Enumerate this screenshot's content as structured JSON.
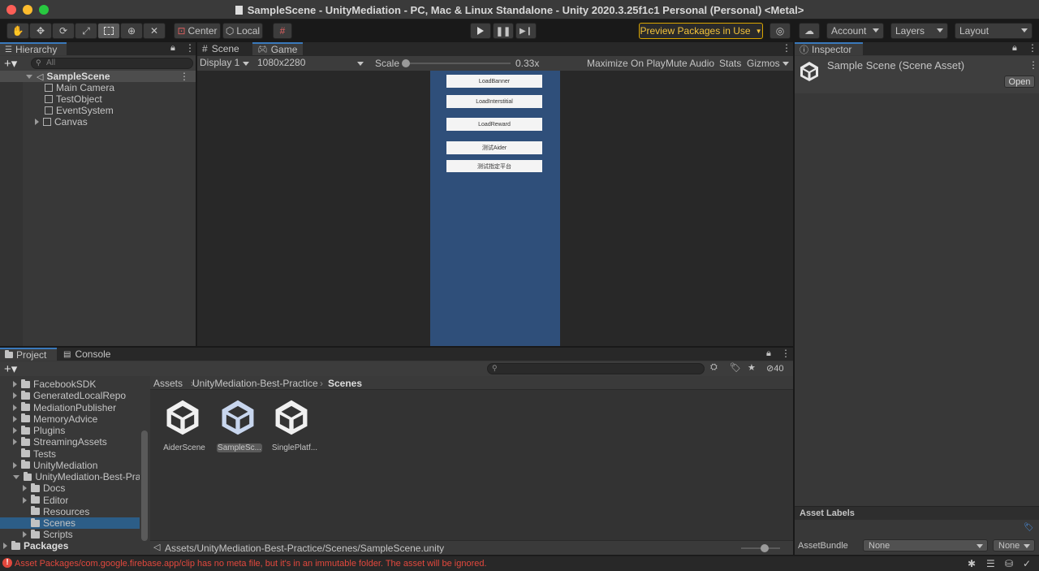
{
  "window": {
    "title": "SampleScene - UnityMediation - PC, Mac & Linux Standalone - Unity 2020.3.25f1c1 Personal (Personal) <Metal>"
  },
  "toolbar": {
    "center_label": "Center",
    "local_label": "Local",
    "preview_packages_label": "Preview Packages in Use",
    "account_label": "Account",
    "layers_label": "Layers",
    "layout_label": "Layout"
  },
  "hierarchy": {
    "tab_label": "Hierarchy",
    "search_placeholder": "All",
    "scene_name": "SampleScene",
    "items": [
      {
        "label": "Main Camera"
      },
      {
        "label": "TestObject"
      },
      {
        "label": "EventSystem"
      },
      {
        "label": "Canvas"
      }
    ]
  },
  "game_view": {
    "tab_scene": "Scene",
    "tab_game": "Game",
    "display": "Display 1",
    "resolution": "1080x2280",
    "scale_label": "Scale",
    "scale_value": "0.33x",
    "scale_slider_fraction": 0.0,
    "maximize_label": "Maximize On Play",
    "mute_label": "Mute Audio",
    "stats_label": "Stats",
    "gizmos_label": "Gizmos",
    "background_color": "#2f4f7a",
    "buttons": [
      "LoadBanner",
      "LoadInterstitial",
      "LoadReward",
      "测试Aider",
      "测试指定平台"
    ]
  },
  "inspector": {
    "tab_label": "Inspector",
    "asset_title": "Sample Scene (Scene Asset)",
    "open_label": "Open",
    "asset_labels_title": "Asset Labels",
    "asset_bundle_label": "AssetBundle",
    "asset_bundle_value": "None",
    "asset_bundle_variant": "None"
  },
  "project": {
    "tab_project": "Project",
    "tab_console": "Console",
    "hidden_count": "40",
    "tree": [
      {
        "label": "FacebookSDK",
        "indent": 0,
        "expander": "closed"
      },
      {
        "label": "GeneratedLocalRepo",
        "indent": 0,
        "expander": "closed"
      },
      {
        "label": "MediationPublisher",
        "indent": 0,
        "expander": "closed"
      },
      {
        "label": "MemoryAdvice",
        "indent": 0,
        "expander": "closed"
      },
      {
        "label": "Plugins",
        "indent": 0,
        "expander": "closed"
      },
      {
        "label": "StreamingAssets",
        "indent": 0,
        "expander": "closed"
      },
      {
        "label": "Tests",
        "indent": 0,
        "expander": "none"
      },
      {
        "label": "UnityMediation",
        "indent": 0,
        "expander": "closed"
      },
      {
        "label": "UnityMediation-Best-Prac",
        "indent": 0,
        "expander": "open"
      },
      {
        "label": "Docs",
        "indent": 1,
        "expander": "closed"
      },
      {
        "label": "Editor",
        "indent": 1,
        "expander": "closed"
      },
      {
        "label": "Resources",
        "indent": 1,
        "expander": "none"
      },
      {
        "label": "Scenes",
        "indent": 1,
        "expander": "none",
        "selected": true
      },
      {
        "label": "Scripts",
        "indent": 1,
        "expander": "closed"
      }
    ],
    "packages_label": "Packages",
    "breadcrumb": [
      "Assets",
      "UnityMediation-Best-Practice",
      "Scenes"
    ],
    "assets": [
      {
        "label": "AiderScene"
      },
      {
        "label": "SampleSc...",
        "selected": true
      },
      {
        "label": "SinglePlatf..."
      }
    ],
    "footer_path": "Assets/UnityMediation-Best-Practice/Scenes/SampleScene.unity"
  },
  "status": {
    "message": "Asset Packages/com.google.firebase.app/clip has no meta file, but it's in an immutable folder. The asset will be ignored."
  }
}
